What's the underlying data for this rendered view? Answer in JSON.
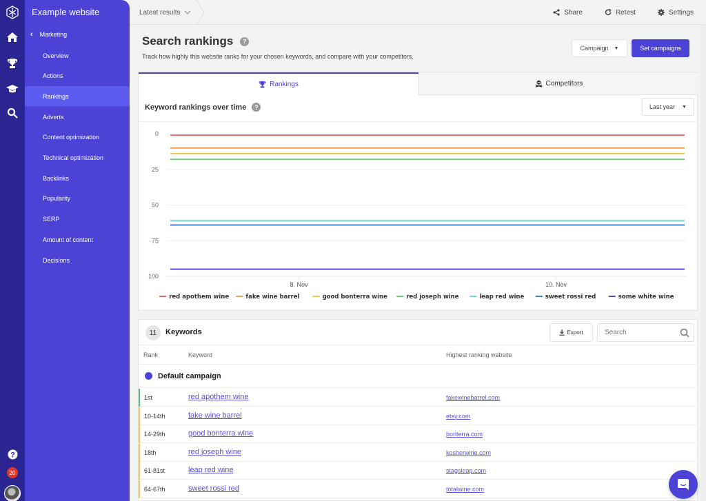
{
  "rail": {
    "icons": [
      "logo-icon",
      "home-icon",
      "trophy-icon",
      "graduation-cap-icon",
      "search-icon",
      "help-icon"
    ],
    "notification_count": "20"
  },
  "sidebar": {
    "site_title": "Example website",
    "section": "Marketing",
    "items": [
      {
        "label": "Overview",
        "active": false
      },
      {
        "label": "Actions",
        "active": false
      },
      {
        "label": "Rankings",
        "active": true
      },
      {
        "label": "Adverts",
        "active": false
      },
      {
        "label": "Content optimization",
        "active": false
      },
      {
        "label": "Technical optimization",
        "active": false
      },
      {
        "label": "Backlinks",
        "active": false
      },
      {
        "label": "Popularity",
        "active": false
      },
      {
        "label": "SERP",
        "active": false
      },
      {
        "label": "Amount of content",
        "active": false
      },
      {
        "label": "Decisions",
        "active": false
      }
    ]
  },
  "topbar": {
    "breadcrumb": "Latest results",
    "share": "Share",
    "retest": "Retest",
    "settings": "Settings"
  },
  "header": {
    "title": "Search rankings",
    "subtitle": "Track how highly this website ranks for your chosen keywords, and compare with your competitors.",
    "campaign_button": "Campaign",
    "set_campaigns_button": "Set campaigns"
  },
  "tabs": [
    {
      "label": "Rankings",
      "active": true
    },
    {
      "label": "Competitors",
      "active": false
    }
  ],
  "chart_panel": {
    "title": "Keyword rankings over time",
    "period": "Last year"
  },
  "chart_data": {
    "type": "line",
    "title": "Keyword rankings over time",
    "xlabel": "",
    "ylabel": "",
    "y_inverted": true,
    "ylim": [
      0,
      100
    ],
    "yticks": [
      0,
      25,
      50,
      75,
      100
    ],
    "xticks": [
      "8. Nov",
      "10. Nov"
    ],
    "x": [
      "7. Nov",
      "8. Nov",
      "9. Nov",
      "10. Nov",
      "11. Nov"
    ],
    "grid": true,
    "legend": "bottom",
    "series": [
      {
        "name": "red apothem wine",
        "color": "#e86a6a",
        "values": [
          1,
          1,
          1,
          1,
          1
        ]
      },
      {
        "name": "fake wine barrel",
        "color": "#eba451",
        "values": [
          10,
          10,
          10,
          10,
          10
        ]
      },
      {
        "name": "good bonterra wine",
        "color": "#eecb4f",
        "values": [
          14,
          14,
          14,
          14,
          14
        ]
      },
      {
        "name": "red joseph wine",
        "color": "#72cd74",
        "values": [
          18,
          18,
          18,
          18,
          18
        ]
      },
      {
        "name": "leap red wine",
        "color": "#6fdccf",
        "values": [
          61,
          61,
          61,
          61,
          61
        ]
      },
      {
        "name": "sweet rossi red",
        "color": "#4f82d6",
        "values": [
          64,
          64,
          64,
          64,
          64
        ]
      },
      {
        "name": "some white wine",
        "color": "#5a4ad8",
        "values": [
          95,
          95,
          95,
          95,
          95
        ]
      }
    ]
  },
  "keywords": {
    "count": "11",
    "title": "Keywords",
    "export_label": "Export",
    "search_placeholder": "Search",
    "columns": [
      "Rank",
      "Keyword",
      "Highest ranking website"
    ],
    "group": "Default campaign",
    "rows": [
      {
        "rank": "1st",
        "keyword": "red apothem wine",
        "site": "fakewinebarrel.com",
        "status_color": "#5dbb7a"
      },
      {
        "rank": "10-14th",
        "keyword": "fake wine barrel",
        "site": "etsy.com",
        "status_color": "#eecb4f"
      },
      {
        "rank": "14-29th",
        "keyword": "good bonterra wine",
        "site": "bonterra.com",
        "status_color": "#eecb4f"
      },
      {
        "rank": "18th",
        "keyword": "red joseph wine",
        "site": "kosherwine.com",
        "status_color": "#eecb4f"
      },
      {
        "rank": "61-81st",
        "keyword": "leap red wine",
        "site": "stagsleap.com",
        "status_color": "#eecb4f"
      },
      {
        "rank": "64-67th",
        "keyword": "sweet rossi red",
        "site": "totalwine.com",
        "status_color": "#eecb4f"
      }
    ]
  },
  "colors": {
    "brand": "#4c42d6",
    "rail": "#2b2591",
    "active_item": "#5c5cf0"
  }
}
